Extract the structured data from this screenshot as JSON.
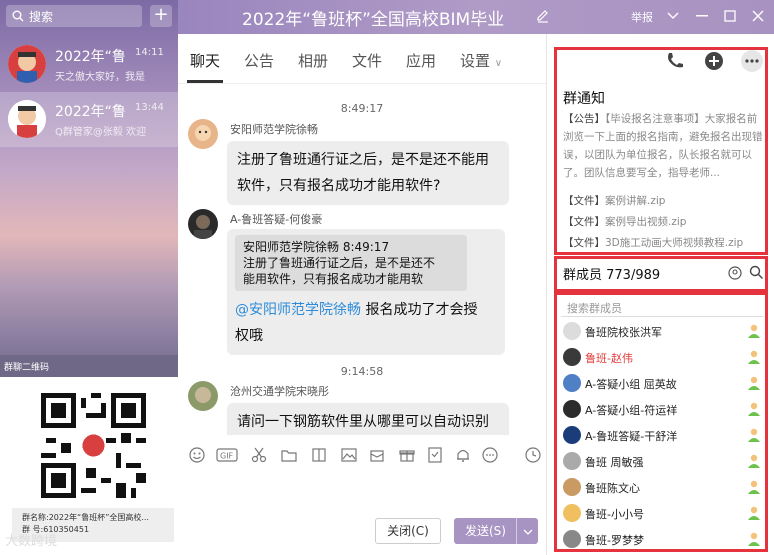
{
  "window": {
    "title": "2022年“鲁班杯”全国高校BIM毕业",
    "report_label": "举报"
  },
  "sidebar": {
    "search_placeholder": "搜索",
    "conversations": [
      {
        "name": "2022年“鲁",
        "time": "14:11",
        "preview": "天之傲大家好，我是"
      },
      {
        "name": "2022年“鲁",
        "time": "13:44",
        "preview": "Q群管家@张毅 欢迎"
      }
    ],
    "qr_header": "群聊二维码",
    "qr_info_name": "群名称:2022年“鲁班杯”全国高校...",
    "qr_info_number": "群  号:610350451",
    "brand": "大数跨境"
  },
  "chat": {
    "tabs": [
      "聊天",
      "公告",
      "相册",
      "文件",
      "应用",
      "设置"
    ],
    "messages": {
      "t1": "8:49:17",
      "m1_sender": "安阳师范学院徐畅",
      "m1_line1": "注册了鲁班通行证之后，是不是还不能用",
      "m1_line2": "软件，只有报名成功才能用软件?",
      "m2_sender": "A-鲁班答疑-何俊豪",
      "m2_quote_head": "安阳师范学院徐畅    8:49:17",
      "m2_quote_l1": "注册了鲁班通行证之后，是不是还不",
      "m2_quote_l2": "能用软件，只有报名成功才能用软",
      "m2_at": "@安阳师范学院徐畅",
      "m2_text1": " 报名成功了才会授",
      "m2_text2": "权哦",
      "t2": "9:14:58",
      "m3_sender": "沧州交通学院宋晓彤",
      "m3_line1": "请问一下钢筋软件里从哪里可以自动识别"
    },
    "close_label": "关闭(C)",
    "send_label": "发送(S)"
  },
  "right": {
    "notice_title": "群通知",
    "notice_tag": "【公告】",
    "notice_text": "【毕设报名注意事项】大家报名前浏览一下上面的报名指南，避免报名出现错误，以团队为单位报名，队长报名就可以了。团队信息要写全，指导老师...",
    "files": [
      {
        "tag": "【文件】",
        "name": "案例讲解.zip"
      },
      {
        "tag": "【文件】",
        "name": "案例导出视频.zip"
      },
      {
        "tag": "【文件】",
        "name": "3D施工动画大师视频教程.zip"
      }
    ],
    "members_title": "群成员 773/989",
    "member_search_placeholder": "搜索群成员",
    "members": [
      {
        "name": "鲁班院校张洪军",
        "red": false
      },
      {
        "name": "鲁班-赵伟",
        "red": true
      },
      {
        "name": "A-答疑小组 屈英故",
        "red": false
      },
      {
        "name": "A-答疑小组-符运祥",
        "red": false
      },
      {
        "name": "A-鲁班答疑-干舒洋",
        "red": false
      },
      {
        "name": "鲁班  周敏强",
        "red": false
      },
      {
        "name": "鲁班陈文心",
        "red": false
      },
      {
        "name": "鲁班-小小号",
        "red": false
      },
      {
        "name": "鲁班-罗梦梦",
        "red": false
      }
    ]
  },
  "colors": {
    "accent": "#a894c2",
    "highlight_box": "#e5333d",
    "at_link": "#2d8cd9"
  }
}
